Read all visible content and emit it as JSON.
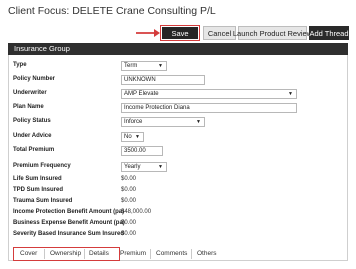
{
  "header": {
    "client_focus": "Client Focus: DELETE Crane Consulting P/L"
  },
  "toolbar": {
    "save_label": "Save",
    "cancel_label": "Cancel",
    "launch_label": "Launch Product Review",
    "add_thread_label": "Add Thread",
    "accent_color": "#d43c3c"
  },
  "group": {
    "title": "Insurance Group"
  },
  "fields": {
    "type": {
      "label": "Type",
      "value": "Term"
    },
    "policy_number": {
      "label": "Policy Number",
      "value": "UNKNOWN"
    },
    "underwriter": {
      "label": "Underwriter",
      "value": "AMP Elevate"
    },
    "plan_name": {
      "label": "Plan Name",
      "value": "Income Protection Diana"
    },
    "policy_status": {
      "label": "Policy Status",
      "value": "Inforce"
    },
    "under_advice": {
      "label": "Under Advice",
      "value": "No"
    },
    "total_premium": {
      "label": "Total Premium",
      "value": "3500.00"
    },
    "premium_frequency": {
      "label": "Premium Frequency",
      "value": "Yearly"
    },
    "life_sum_insured": {
      "label": "Life Sum Insured",
      "value": "$0.00"
    },
    "tpd_sum_insured": {
      "label": "TPD Sum Insured",
      "value": "$0.00"
    },
    "trauma_sum_insured": {
      "label": "Trauma Sum Insured",
      "value": "$0.00"
    },
    "income_protection": {
      "label": "Income Protection Benefit Amount (pa)",
      "value": "$48,000.00"
    },
    "business_expense": {
      "label": "Business Expense Benefit Amount (pa)",
      "value": "$0.00"
    },
    "severity_based": {
      "label": "Severity Based Insurance Sum Insured",
      "value": "$0.00"
    }
  },
  "tabs": {
    "cover": "Cover",
    "ownership": "Ownership",
    "details": "Details",
    "premium": "Premium",
    "comments": "Comments",
    "others": "Others"
  }
}
